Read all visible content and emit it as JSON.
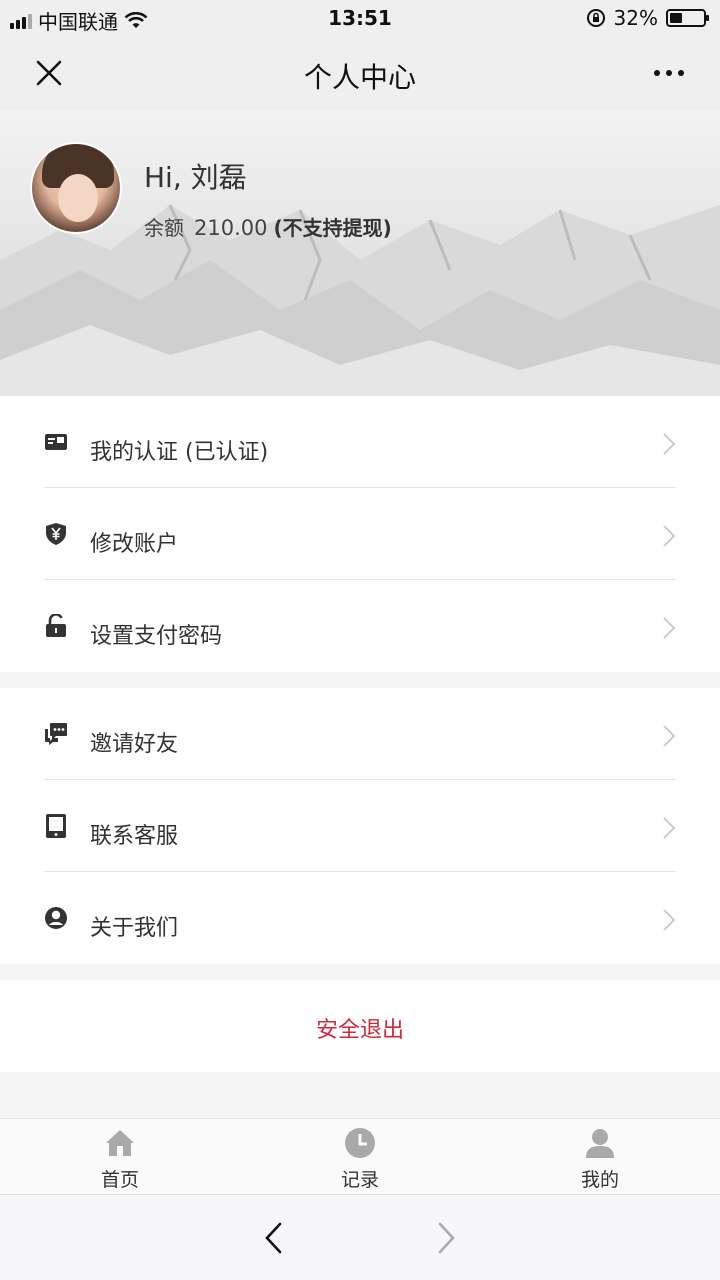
{
  "status_bar": {
    "carrier": "中国联通",
    "time": "13:51",
    "battery_percent": "32%",
    "battery_level": 0.32
  },
  "nav": {
    "title": "个人中心"
  },
  "profile": {
    "greeting": "Hi, 刘磊",
    "balance_label": "余额",
    "balance_value": "210.00",
    "balance_note": "(不支持提现)"
  },
  "menu": {
    "group1": [
      {
        "label": "我的认证 (已认证)",
        "icon": "id-card-icon"
      },
      {
        "label": "修改账户",
        "icon": "yen-shield-icon"
      },
      {
        "label": "设置支付密码",
        "icon": "unlock-icon"
      }
    ],
    "group2": [
      {
        "label": "邀请好友",
        "icon": "chat-bubbles-icon"
      },
      {
        "label": "联系客服",
        "icon": "tablet-icon"
      },
      {
        "label": "关于我们",
        "icon": "user-circle-icon"
      }
    ]
  },
  "logout": {
    "label": "安全退出",
    "color": "#d0293a"
  },
  "tab_bar": {
    "tabs": [
      {
        "label": "首页",
        "icon": "home-icon"
      },
      {
        "label": "记录",
        "icon": "clock-icon"
      },
      {
        "label": "我的",
        "icon": "person-icon"
      }
    ]
  }
}
